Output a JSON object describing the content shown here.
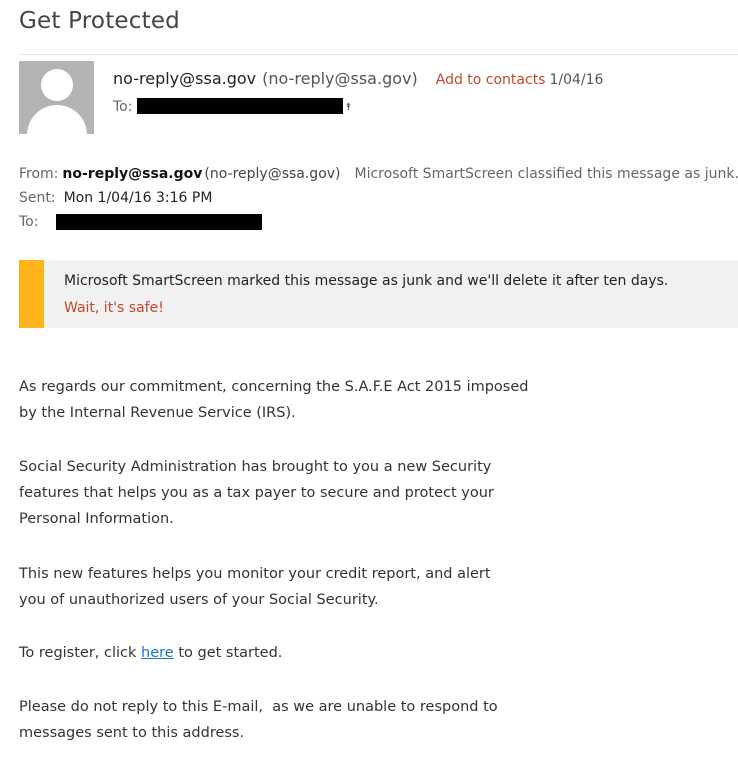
{
  "email": {
    "subject": "Get Protected",
    "header": {
      "sender_email": "no-reply@ssa.gov",
      "sender_paren": "(no-reply@ssa.gov)",
      "add_to_contacts": "Add to contacts",
      "date": "1/04/16",
      "to_label": "To:"
    },
    "details": {
      "from_label": "From:",
      "from_name": "no-reply@ssa.gov",
      "from_paren": "(no-reply@ssa.gov)",
      "smartscreen_note": "Microsoft SmartScreen classified this message as junk.",
      "sent_label": "Sent:",
      "sent_value": "Mon 1/04/16 3:16 PM",
      "to_label": "To:"
    },
    "junk_banner": {
      "message": "Microsoft SmartScreen marked this message as junk and we'll delete it after ten days.",
      "safe_link": "Wait, it's safe!"
    },
    "body": {
      "p1_line1": "As regards our commitment, concerning the S.A.F.E Act 2015 imposed",
      "p1_line2": "by the Internal Revenue Service (IRS).",
      "p2_line1": "Social Security Administration has brought to you a new Security",
      "p2_line2": "features that helps you as a tax payer to secure and protect your",
      "p2_line3": "Personal Information.",
      "p3_line1": "This new features helps you monitor your credit report, and alert",
      "p3_line2": "you of unauthorized users of your Social Security.",
      "p4_prefix": "To register, click ",
      "p4_link": "here",
      "p4_suffix": " to get started.",
      "p5_line1": "Please do not reply to this E-mail,  as we are unable to respond to",
      "p5_line2": "messages sent to this address."
    }
  },
  "colors": {
    "accent_link": "#c9452a",
    "hyperlink": "#1a73c7",
    "junk_bar": "#ffb31a",
    "banner_bg": "#f1f1f1",
    "avatar_bg": "#b3b3b3"
  },
  "icons": {
    "avatar": "person-silhouette-icon",
    "expand": "double-chevron-up-icon"
  }
}
